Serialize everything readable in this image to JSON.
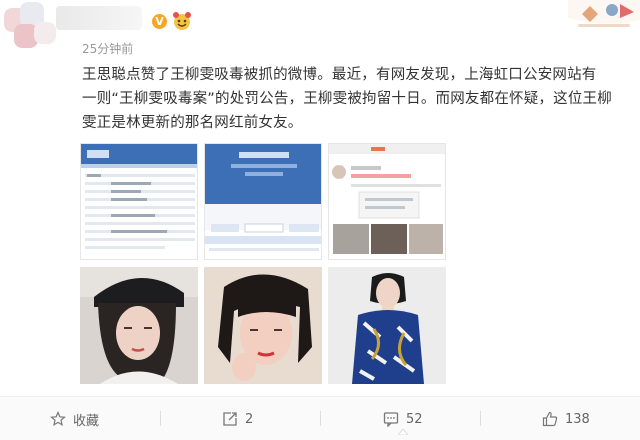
{
  "post": {
    "badge": "V",
    "timestamp": "25分钟前",
    "content": "王思聪点赞了王柳雯吸毒被抓的微博。最近，有网友发现，上海虹口公安网站有\n一则“王柳雯吸毒案”的处罚公告，王柳雯被拘留十日。而网友都在怀疑，这位王柳\n雯正是林更新的那名网红前女友。"
  },
  "colors": {
    "accent": "#eb7350",
    "weibo_blue": "#3d6fb6",
    "vip_orange": "#f6a623"
  },
  "icons": [
    "star-icon",
    "repost-icon",
    "comment-icon",
    "like-icon",
    "emoji-badge-icon"
  ],
  "actions": {
    "favorite_label": "收藏",
    "repost_count": "2",
    "comment_count": "52",
    "like_count": "138"
  }
}
